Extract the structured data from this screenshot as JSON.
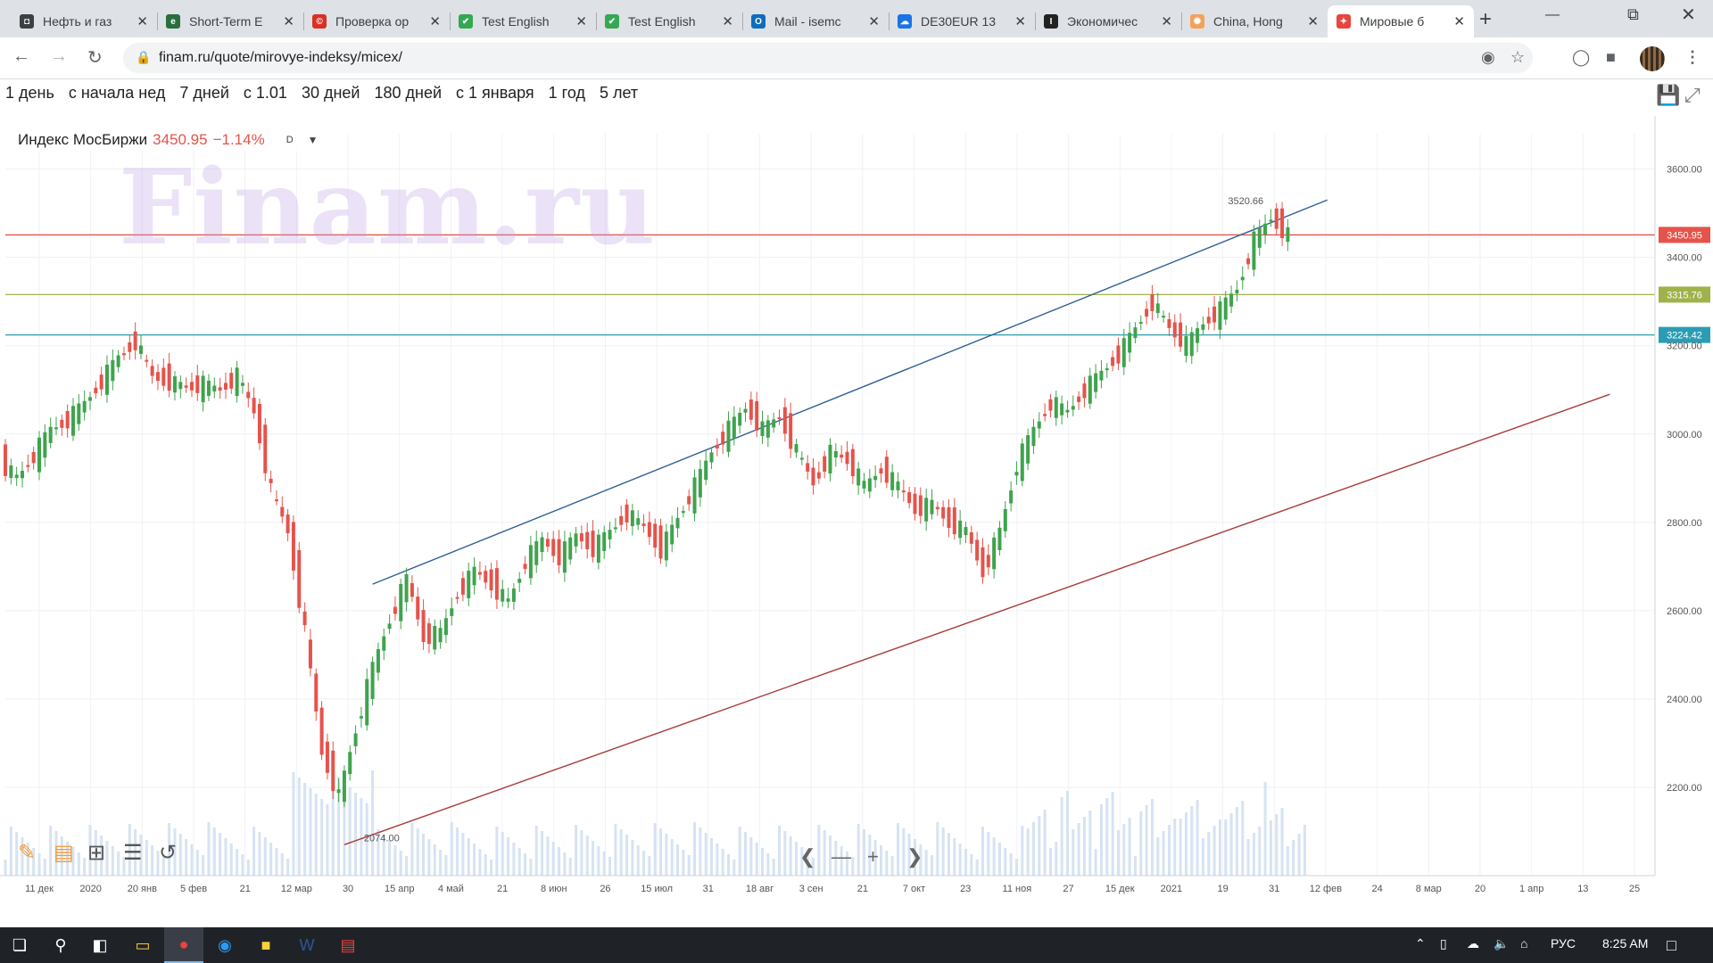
{
  "browser": {
    "tabs": [
      {
        "title": "Нефть и газ",
        "icon": "page-icon",
        "color": "#3c4043",
        "active": false
      },
      {
        "title": "Short-Term E",
        "icon": "eia-icon",
        "color": "#2a6e3f",
        "active": false
      },
      {
        "title": "Проверка ор",
        "icon": "copyright-icon",
        "color": "#d93025",
        "active": false
      },
      {
        "title": "Test English",
        "icon": "check-icon",
        "color": "#34a853",
        "active": false
      },
      {
        "title": "Test English",
        "icon": "check-icon",
        "color": "#34a853",
        "active": false
      },
      {
        "title": "Mail - isemc",
        "icon": "outlook-icon",
        "color": "#0f6cbd",
        "active": false
      },
      {
        "title": "DE30EUR 13",
        "icon": "cloud-icon",
        "color": "#1a73e8",
        "active": false
      },
      {
        "title": "Экономичес",
        "icon": "investing-icon",
        "color": "#222222",
        "active": false
      },
      {
        "title": "China, Hong",
        "icon": "swirl-icon",
        "color": "#f4a259",
        "active": false
      },
      {
        "title": "Мировые б",
        "icon": "finam-icon",
        "color": "#e8453c",
        "active": true
      }
    ],
    "url": "finam.ru/quote/mirovye-indeksy/micex/"
  },
  "periods": [
    "1 день",
    "с начала нед",
    "7 дней",
    "с 1.01",
    "30 дней",
    "180 дней",
    "с 1 января",
    "1 год",
    "5 лет"
  ],
  "legend": {
    "name": "Индекс МосБиржи",
    "value": "3450.95",
    "change": "−1.14%",
    "interval": "D"
  },
  "watermark": "Finam.ru",
  "chart_data": {
    "type": "candlestick",
    "ylim": [
      2000,
      3680
    ],
    "y_ticks": [
      2200,
      2400,
      2600,
      2800,
      3000,
      3200,
      3400,
      3600
    ],
    "y_tick_labels": [
      "2200.00",
      "2400.00",
      "2600.00",
      "2800.00",
      "3000.00",
      "3200.00",
      "3400.00",
      "3600.00"
    ],
    "x_tick_labels": [
      "11 дек",
      "2020",
      "20 янв",
      "5 фев",
      "21",
      "12 мар",
      "30",
      "15 апр",
      "4 май",
      "21",
      "8 июн",
      "26",
      "15 июл",
      "31",
      "18 авг",
      "3 сен",
      "21",
      "7 окт",
      "23",
      "11 ноя",
      "27",
      "15 дек",
      "2021",
      "19",
      "31",
      "12 фев",
      "24",
      "8 мар",
      "20",
      "1 апр",
      "13",
      "25"
    ],
    "price_series": [
      [
        0,
        2940
      ],
      [
        3,
        2900
      ],
      [
        6,
        2950
      ],
      [
        9,
        3010
      ],
      [
        12,
        3030
      ],
      [
        15,
        3070
      ],
      [
        18,
        3120
      ],
      [
        21,
        3175
      ],
      [
        24,
        3210
      ],
      [
        27,
        3130
      ],
      [
        30,
        3120
      ],
      [
        33,
        3105
      ],
      [
        36,
        3110
      ],
      [
        39,
        3100
      ],
      [
        42,
        3130
      ],
      [
        45,
        3050
      ],
      [
        48,
        2870
      ],
      [
        51,
        2780
      ],
      [
        54,
        2550
      ],
      [
        57,
        2280
      ],
      [
        60,
        2180
      ],
      [
        63,
        2330
      ],
      [
        66,
        2470
      ],
      [
        69,
        2580
      ],
      [
        72,
        2670
      ],
      [
        75,
        2540
      ],
      [
        78,
        2550
      ],
      [
        81,
        2640
      ],
      [
        84,
        2690
      ],
      [
        87,
        2660
      ],
      [
        90,
        2620
      ],
      [
        93,
        2710
      ],
      [
        96,
        2760
      ],
      [
        99,
        2720
      ],
      [
        102,
        2770
      ],
      [
        105,
        2740
      ],
      [
        108,
        2780
      ],
      [
        111,
        2820
      ],
      [
        114,
        2790
      ],
      [
        117,
        2740
      ],
      [
        120,
        2810
      ],
      [
        123,
        2880
      ],
      [
        126,
        2960
      ],
      [
        129,
        3010
      ],
      [
        132,
        3060
      ],
      [
        135,
        3010
      ],
      [
        138,
        3040
      ],
      [
        141,
        2960
      ],
      [
        144,
        2890
      ],
      [
        147,
        2960
      ],
      [
        150,
        2940
      ],
      [
        153,
        2880
      ],
      [
        156,
        2920
      ],
      [
        159,
        2880
      ],
      [
        162,
        2830
      ],
      [
        165,
        2840
      ],
      [
        168,
        2800
      ],
      [
        171,
        2780
      ],
      [
        174,
        2690
      ],
      [
        177,
        2780
      ],
      [
        180,
        2930
      ],
      [
        183,
        3010
      ],
      [
        186,
        3070
      ],
      [
        189,
        3050
      ],
      [
        192,
        3100
      ],
      [
        195,
        3140
      ],
      [
        198,
        3180
      ],
      [
        201,
        3240
      ],
      [
        204,
        3300
      ],
      [
        207,
        3240
      ],
      [
        210,
        3200
      ],
      [
        213,
        3250
      ],
      [
        216,
        3280
      ],
      [
        219,
        3330
      ],
      [
        222,
        3440
      ],
      [
        225,
        3490
      ],
      [
        228,
        3450.95
      ]
    ],
    "horizontal_levels": [
      {
        "value": 3450.95,
        "label": "3450.95",
        "color": "#e5534b"
      },
      {
        "value": 3315.76,
        "label": "3315.76",
        "color": "#9fb24a"
      },
      {
        "value": 3224.42,
        "label": "3224.42",
        "color": "#2a9db5"
      }
    ],
    "trendlines": [
      {
        "from": [
          65,
          2660
        ],
        "to": [
          234,
          3530
        ],
        "color": "#2f5f98"
      },
      {
        "from": [
          60,
          2070
        ],
        "to": [
          284,
          3090
        ],
        "color": "#a93a3a"
      }
    ],
    "annotations": [
      {
        "text": "3520.66",
        "at": [
          224,
          3520
        ]
      },
      {
        "text": "2074.00",
        "at": [
          60,
          2074
        ]
      }
    ]
  },
  "taskbar": {
    "lang": "РУС",
    "time": "8:25 AM"
  }
}
